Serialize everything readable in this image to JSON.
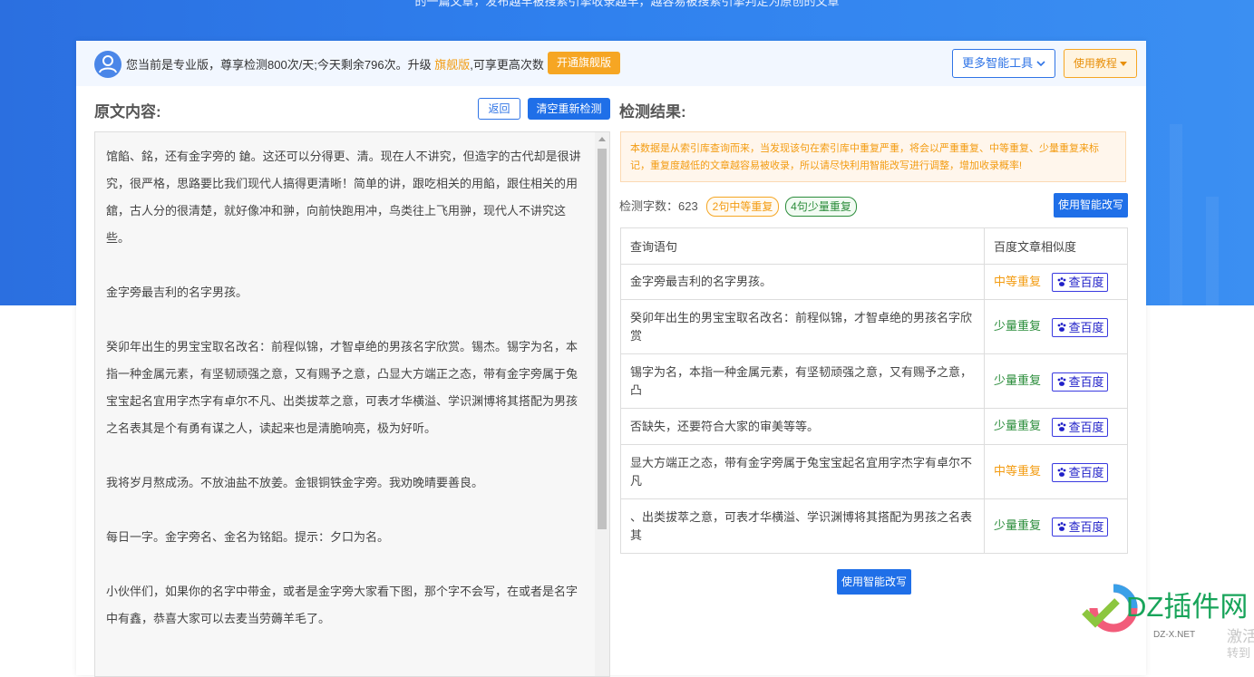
{
  "hero": {
    "text": "的一篇文章，发布越早被搜索引擎收录越早，越容易被搜索引擎判定为原创的文章"
  },
  "topbar": {
    "notice_prefix": "您当前是专业版，尊享检测800次/天;今天剩余796次。升级 ",
    "notice_link": "旗舰版",
    "notice_suffix": ",可享更高次数",
    "open_button": "开通旗舰版",
    "tools_button": "更多智能工具",
    "guide_button": "使用教程"
  },
  "left": {
    "title": "原文内容:",
    "back_button": "返回",
    "clear_button": "清空重新检测",
    "paragraphs": [
      "馆餡、銘，还有金字旁的 鎗。这还可以分得更、清。现在人不讲究，但造字的古代却是很讲究，很严格，思路要比我们现代人搞得更清晰！简单的讲，跟吃相关的用餡，跟住相关的用舘，古人分的很清楚，就好像冲和翀，向前快跑用冲，鸟类往上飞用翀，现代人不讲究这些。",
      "金字旁最吉利的名字男孩。",
      "癸卯年出生的男宝宝取名改名：前程似锦，才智卓绝的男孩名字欣赏。锡杰。锡字为名，本指一种金属元素，有坚韧顽强之意，又有赐予之意，凸显大方端正之态，带有金字旁属于兔宝宝起名宜用字杰字有卓尔不凡、出类拔萃之意，可表才华横溢、学识渊博将其搭配为男孩之名表其是个有勇有谋之人，读起来也是清脆响亮，极为好听。",
      "我将岁月熬成汤。不放油盐不放姜。金银铜铁金字旁。我劝晚晴要善良。",
      "每日一字。金字旁名、金名为铭鋁。提示：夕口为名。",
      "小伙伴们，如果你的名字中带金，或者是金字旁大家看下图，那个字不会写，在或者是名字中有鑫，恭喜大家可以去麦当劳薅羊毛了。"
    ]
  },
  "right": {
    "title": "检测结果:",
    "warning": "本数据是从索引库查询而来，当发现该句在索引库中重复严重，将会以严重重复、中等重复、少量重复来标记，重复度越低的文章越容易被收录，所以请尽快利用智能改写进行调整，增加收录概率!",
    "stats_label": "检测字数：623",
    "tag_mid": "2句中等重复",
    "tag_low": "4句少量重复",
    "rewrite_button": "使用智能改写",
    "table": {
      "headers": [
        "查询语句",
        "百度文章相似度"
      ],
      "rows": [
        {
          "sentence": "金字旁最吉利的名字男孩。",
          "level": "中等重复",
          "type": "mid",
          "action": "查百度"
        },
        {
          "sentence": "癸卯年出生的男宝宝取名改名：前程似锦，才智卓绝的男孩名字欣赏",
          "level": "少量重复",
          "type": "low",
          "action": "查百度"
        },
        {
          "sentence": "锡字为名，本指一种金属元素，有坚韧顽强之意，又有赐予之意，凸",
          "level": "少量重复",
          "type": "low",
          "action": "查百度"
        },
        {
          "sentence": "否缺失，还要符合大家的审美等等。",
          "level": "少量重复",
          "type": "low",
          "action": "查百度"
        },
        {
          "sentence": "显大方端正之态，带有金字旁属于兔宝宝起名宜用字杰字有卓尔不凡",
          "level": "中等重复",
          "type": "mid",
          "action": "查百度"
        },
        {
          "sentence": "、出类拔萃之意，可表才华横溢、学识渊博将其搭配为男孩之名表其",
          "level": "少量重复",
          "type": "low",
          "action": "查百度"
        }
      ]
    },
    "bottom_rewrite_button": "使用智能改写"
  },
  "watermark": {
    "brand": "DZ插件网",
    "url": "DZ-X.NET",
    "side_text_1": "激活",
    "side_text_2": "转到"
  }
}
